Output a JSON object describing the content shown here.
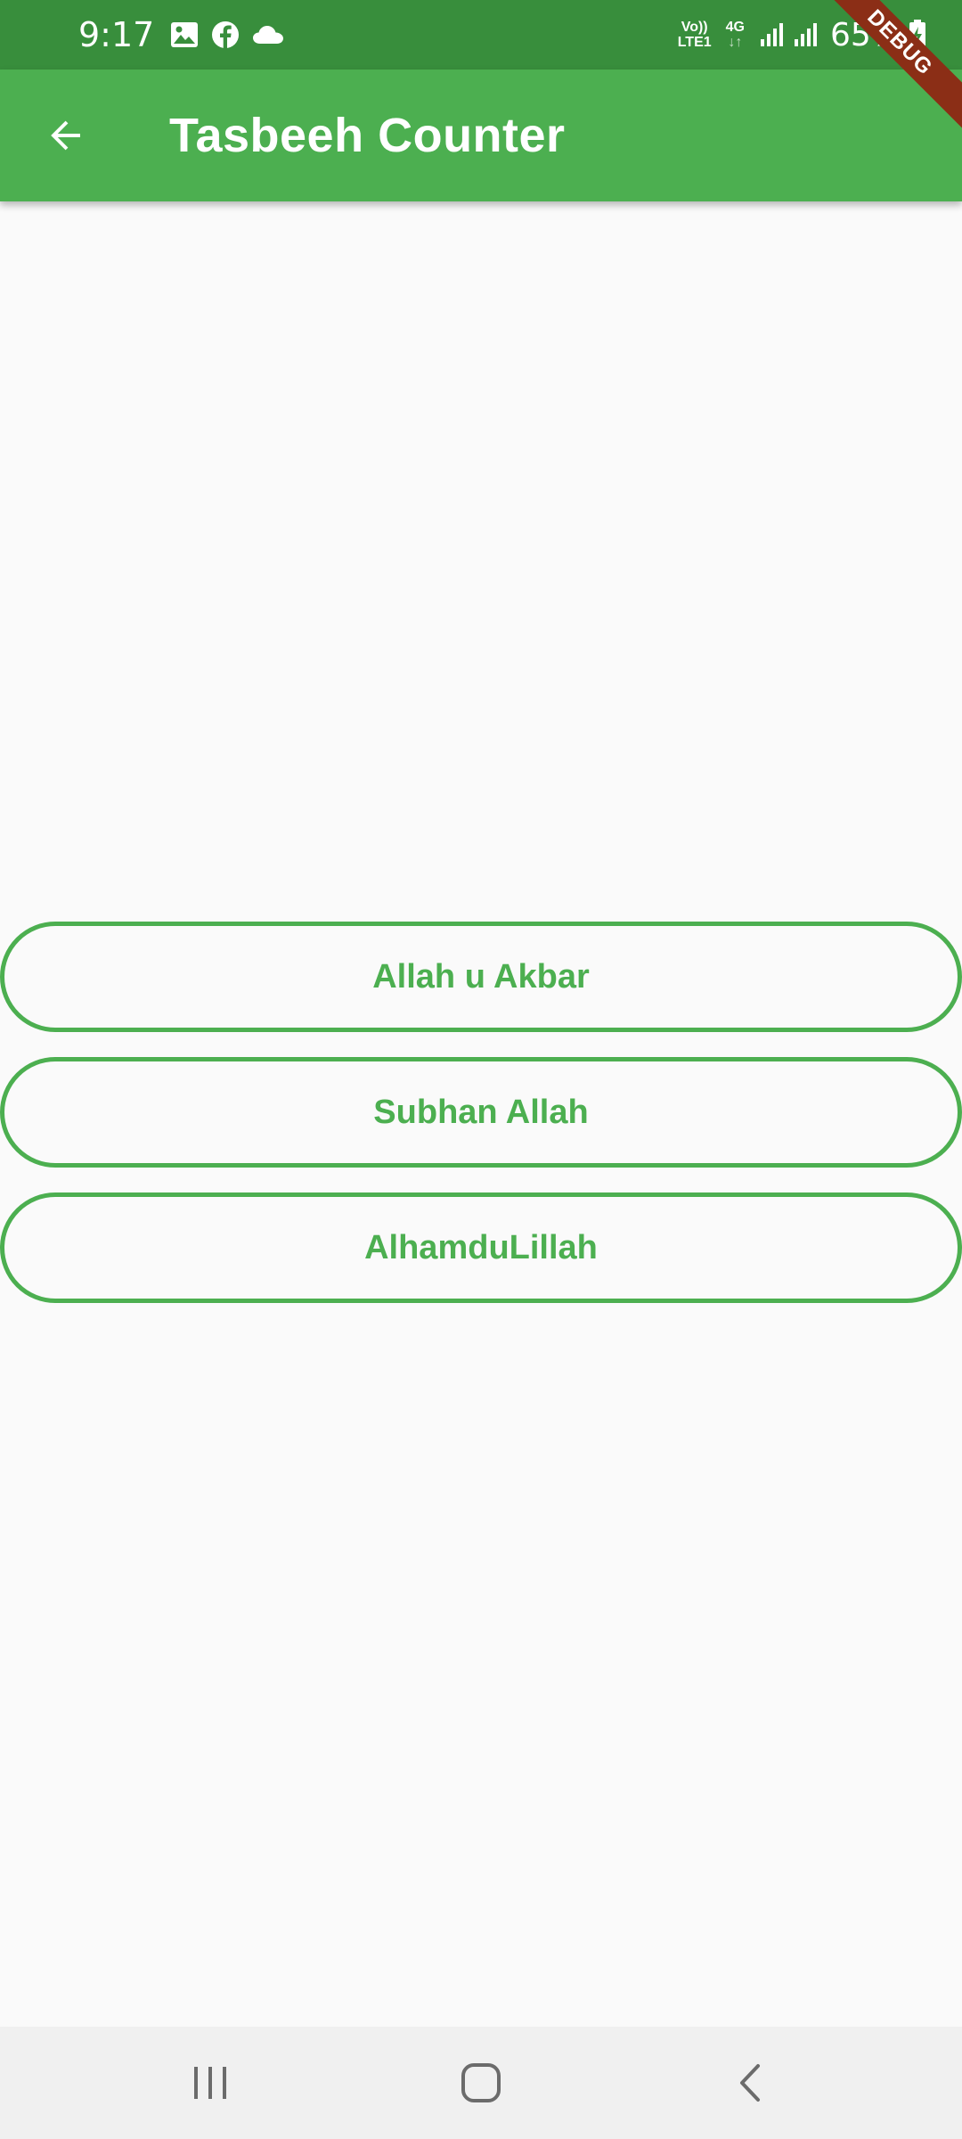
{
  "status_bar": {
    "time": "9:17",
    "notification_icons": [
      "image-icon",
      "facebook-icon",
      "cloud-icon"
    ],
    "volte_label_top": "Vo))",
    "volte_label_bottom": "LTE1",
    "network_type": "4G",
    "battery_percent": "65%"
  },
  "app_bar": {
    "title": "Tasbeeh Counter",
    "back_icon": "arrow-left-icon"
  },
  "debug_banner": {
    "label": "DEBUG"
  },
  "tasbeeh_buttons": [
    {
      "label": "Allah u Akbar"
    },
    {
      "label": "Subhan Allah"
    },
    {
      "label": "AlhamduLillah"
    }
  ],
  "nav_bar": {
    "icons": [
      "recents-icon",
      "home-icon",
      "back-icon"
    ]
  },
  "colors": {
    "status_bar": "#388e3c",
    "primary": "#4caf50",
    "background": "#fafafa",
    "debug_banner": "#8b2e16"
  }
}
